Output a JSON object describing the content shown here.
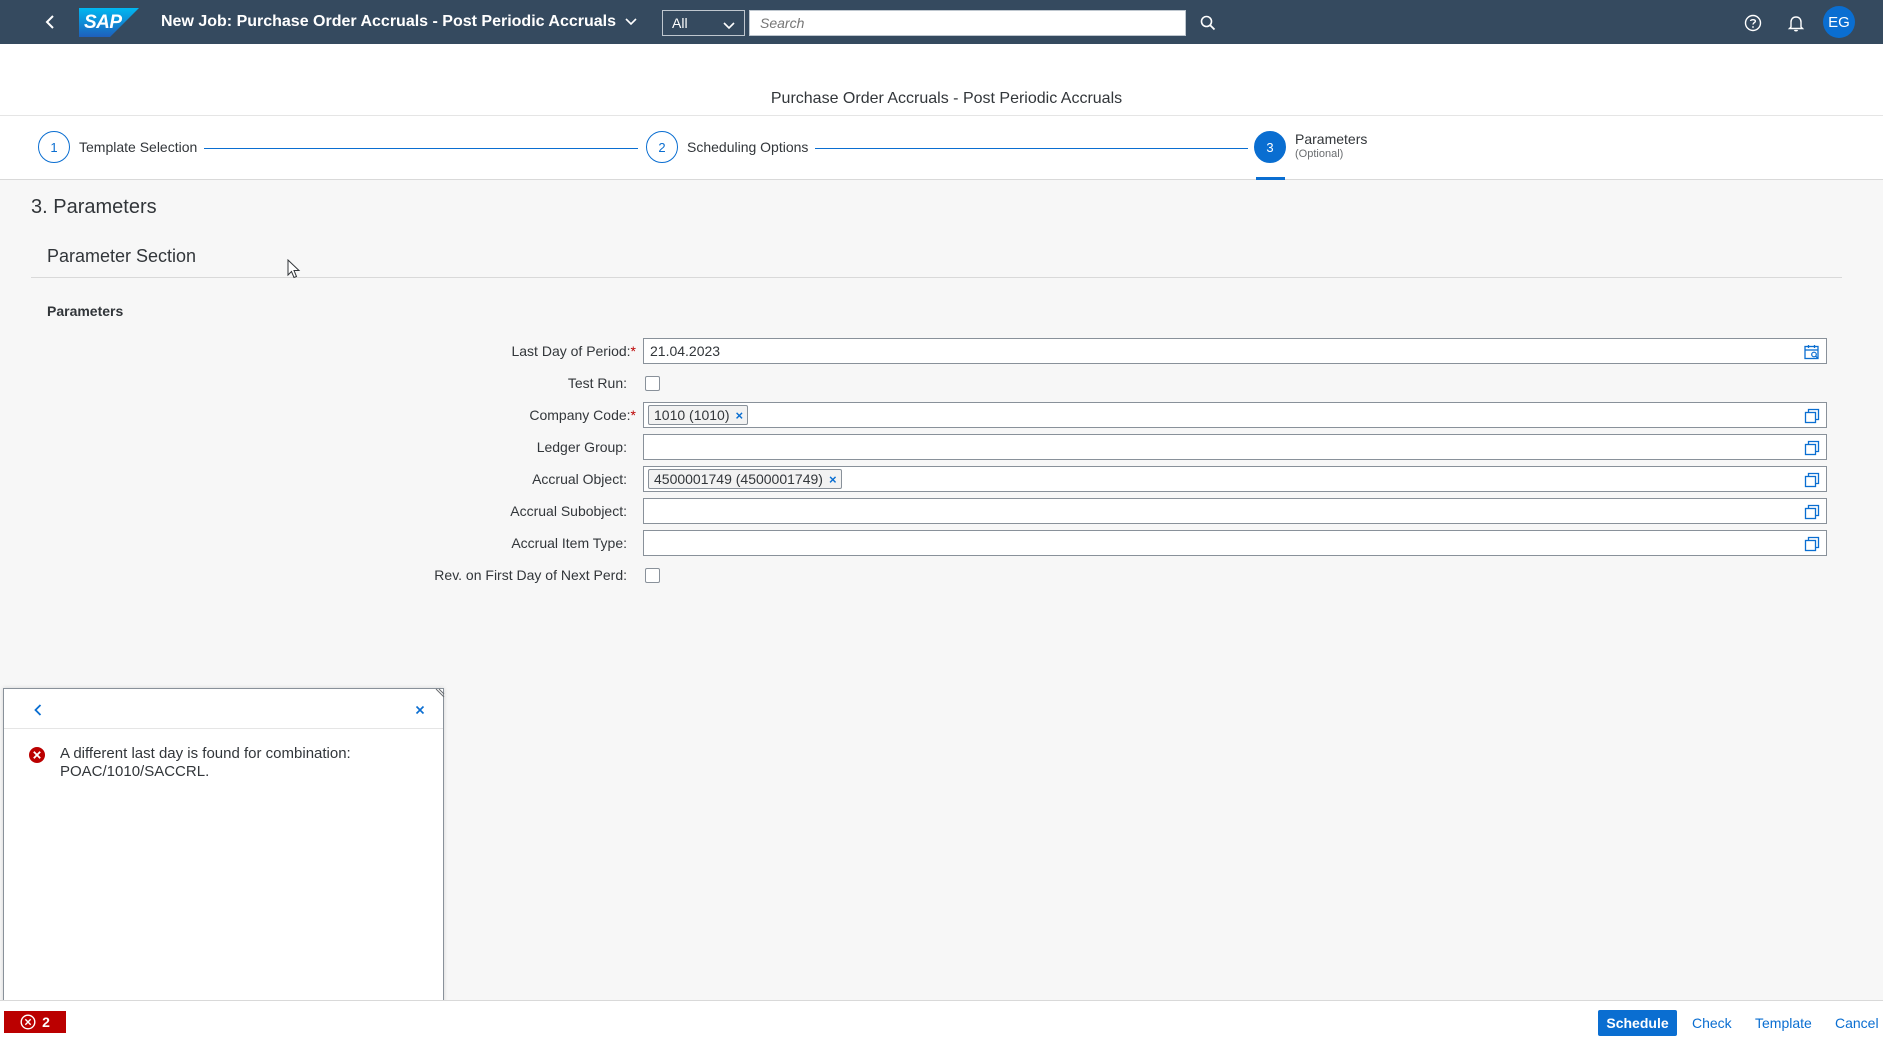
{
  "shell": {
    "app_title": "New Job: Purchase Order Accruals - Post Periodic Accruals",
    "logo_text": "SAP",
    "scope_value": "All",
    "search_placeholder": "Search",
    "avatar_initials": "EG"
  },
  "wizard": {
    "page_title": "Purchase Order Accruals - Post Periodic Accruals",
    "steps": [
      {
        "number": "1",
        "label": "Template Selection"
      },
      {
        "number": "2",
        "label": "Scheduling Options"
      },
      {
        "number": "3",
        "label": "Parameters",
        "sublabel": "(Optional)"
      }
    ]
  },
  "content": {
    "section_title": "3. Parameters",
    "subsection_title": "Parameter Section",
    "group_title": "Parameters",
    "fields": {
      "last_day": {
        "label": "Last Day of Period:",
        "required": "*",
        "value": "21.04.2023"
      },
      "test_run": {
        "label": "Test Run:"
      },
      "company_code": {
        "label": "Company Code:",
        "required": "*",
        "token": "1010 (1010)"
      },
      "ledger_group": {
        "label": "Ledger Group:"
      },
      "accrual_object": {
        "label": "Accrual Object:",
        "token": "4500001749 (4500001749)"
      },
      "accrual_subobject": {
        "label": "Accrual Subobject:"
      },
      "accrual_item_type": {
        "label": "Accrual Item Type:"
      },
      "rev_first_day": {
        "label": "Rev. on First Day of Next Perd:"
      }
    }
  },
  "popover": {
    "message": "A different last day is found for combination: POAC/1010/SACCRL."
  },
  "footer": {
    "error_count": "2",
    "schedule_label": "Schedule",
    "check_label": "Check",
    "template_label": "Template",
    "cancel_label": "Cancel"
  },
  "colors": {
    "shell_bg": "#354a5f",
    "accent": "#0a6ed1",
    "error": "#bb0000"
  }
}
